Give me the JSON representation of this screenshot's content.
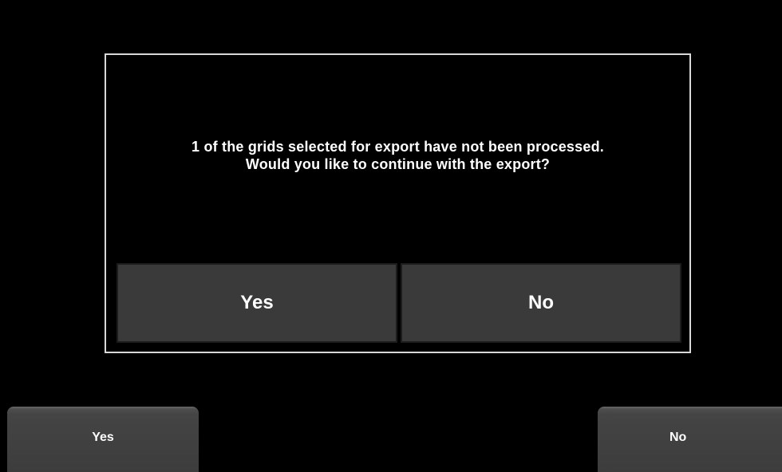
{
  "dialog": {
    "message_line1": "1 of the grids selected for export have not been processed.",
    "message_line2": "Would you like to continue with the export?",
    "yes_label": "Yes",
    "no_label": "No"
  },
  "softkeys": {
    "left_label": "Yes",
    "right_label": "No"
  },
  "colors": {
    "background": "#000000",
    "dialog_border": "#d8d8d8",
    "button_fill": "#3a3a3a",
    "softkey_fill": "#444444",
    "text": "#ffffff"
  }
}
